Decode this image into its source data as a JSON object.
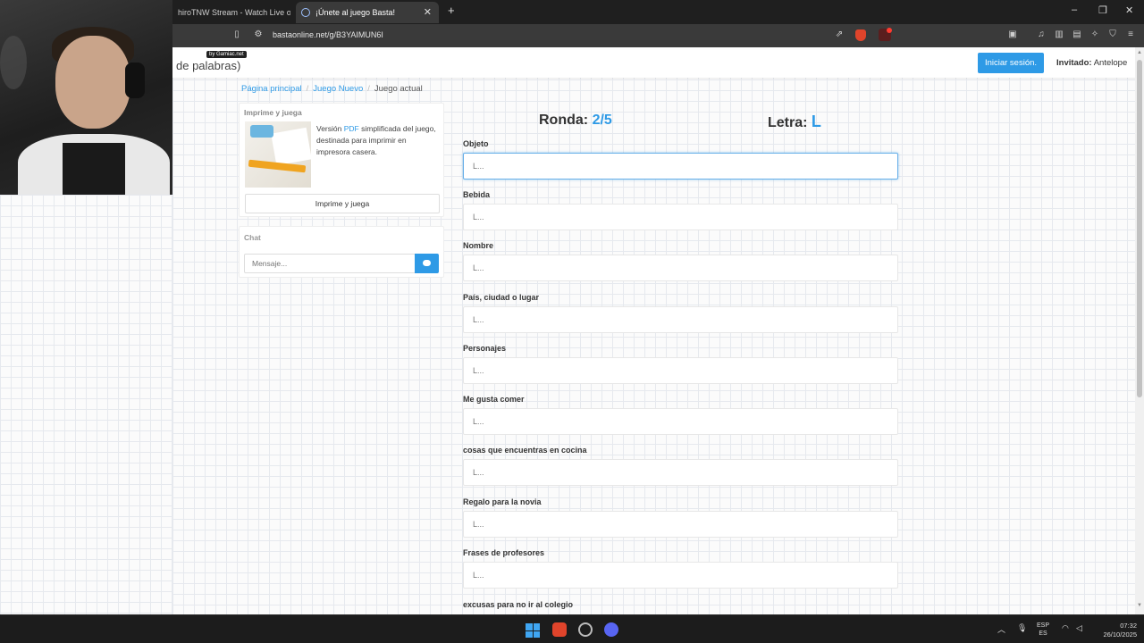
{
  "browser": {
    "tabs": [
      {
        "label": "hiroTNW Stream - Watch Live on Ki",
        "active": false
      },
      {
        "label": "¡Únete al juego Basta!",
        "active": true
      }
    ],
    "url": "bastaonline.net/g/B3YAIMUN6I"
  },
  "header": {
    "brand_text": "de palabras)",
    "brand_badge": "by Gamiac.net",
    "login_label": "Iniciar sesión.",
    "guest_prefix": "Invitado:",
    "guest_name": "Antelope"
  },
  "breadcrumb": [
    "Página principal",
    "Juego Nuevo",
    "Juego actual"
  ],
  "print_panel": {
    "title": "Imprime y juega",
    "desc_prefix": "Versión",
    "desc_link": "PDF",
    "desc_rest": "simplificada del juego, destinada para imprimir en impresora casera.",
    "button_label": "Imprime y juega"
  },
  "chat": {
    "title": "Chat",
    "placeholder": "Mensaje..."
  },
  "game": {
    "round_label": "Ronda:",
    "round_value": "2/5",
    "letter_label": "Letra:",
    "letter_value": "L",
    "fields": [
      {
        "label": "Objeto",
        "placeholder": "L..."
      },
      {
        "label": "Bebida",
        "placeholder": "L..."
      },
      {
        "label": "Nombre",
        "placeholder": "L..."
      },
      {
        "label": "País, ciudad o lugar",
        "placeholder": "L..."
      },
      {
        "label": "Personajes",
        "placeholder": "L..."
      },
      {
        "label": "Me gusta comer",
        "placeholder": "L..."
      },
      {
        "label": "cosas que encuentras en cocina",
        "placeholder": "L..."
      },
      {
        "label": "Regalo para la novia",
        "placeholder": "L..."
      },
      {
        "label": "Frases de profesores",
        "placeholder": "L..."
      },
      {
        "label": "excusas para no ir al colegio",
        "placeholder": ""
      }
    ]
  },
  "taskbar": {
    "lang_top": "ESP",
    "lang_bottom": "ES",
    "time": "07:32",
    "date": "26/10/2025"
  },
  "colors": {
    "accent": "#2e9ae6",
    "page_bg": "#fbfbfb"
  }
}
